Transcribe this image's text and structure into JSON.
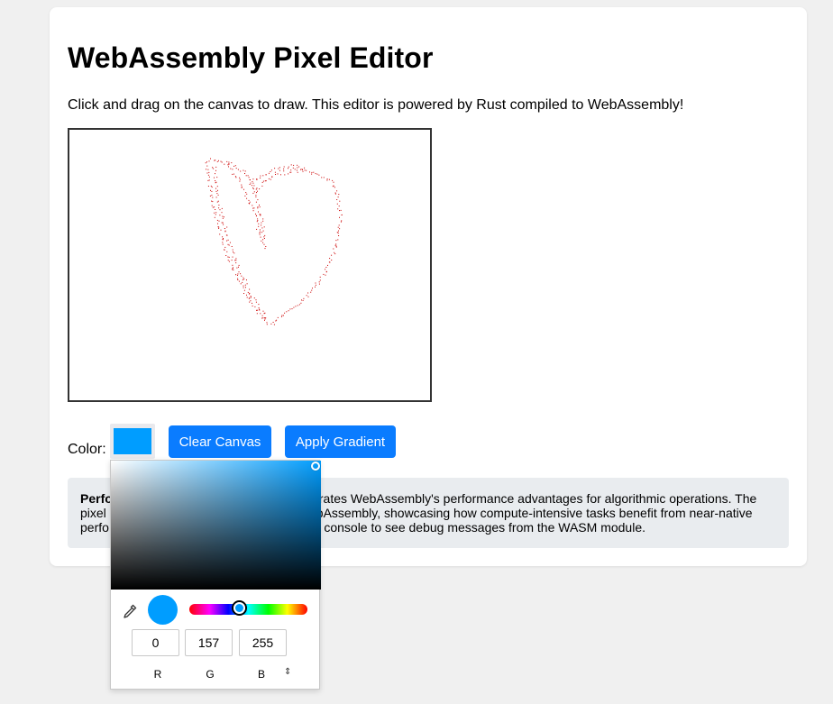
{
  "page": {
    "title": "WebAssembly Pixel Editor",
    "description": "Click and drag on the canvas to draw. This editor is powered by Rust compiled to WebAssembly!"
  },
  "controls": {
    "color_label": "Color:",
    "current_color": "#009dff",
    "clear_label": "Clear Canvas",
    "gradient_label": "Apply Gradient"
  },
  "performance": {
    "visible_bold": "Perfo",
    "line1": "strates WebAssembly's performance advantages for algorithmic operations. The",
    "line2_left": "pixel",
    "line2_right": "ebAssembly, showcasing how compute-intensive tasks benefit from near-native",
    "line3_left": "perfo",
    "line3_right": "er console to see debug messages from the WASM module."
  },
  "color_picker": {
    "r": "0",
    "g": "157",
    "b": "255",
    "r_label": "R",
    "g_label": "G",
    "b_label": "B",
    "mode_toggle": "⇕",
    "icons": [
      "eyedropper-icon"
    ]
  },
  "canvas": {
    "stroke_color": "#cc0000"
  }
}
